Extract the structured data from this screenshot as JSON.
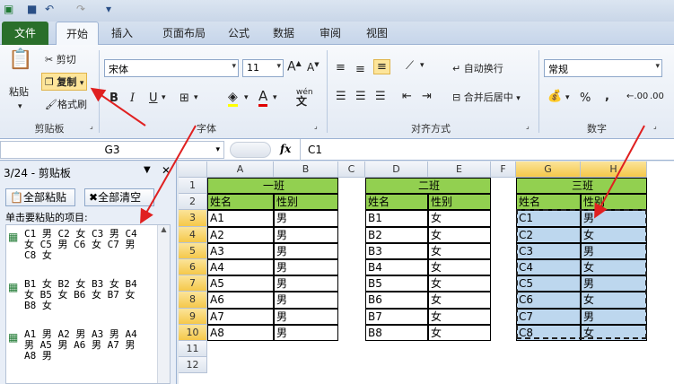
{
  "tabs": [
    "文件",
    "开始",
    "插入",
    "页面布局",
    "公式",
    "数据",
    "审阅",
    "视图"
  ],
  "ribbon": {
    "paste": "粘贴",
    "cut": "剪切",
    "copy": "复制",
    "format_painter": "格式刷",
    "clipboard_group": "剪贴板",
    "font_name": "宋体",
    "font_size": "11",
    "font_group": "字体",
    "wrap_text": "自动换行",
    "merge_center": "合并后居中",
    "align_group": "对齐方式",
    "number_format": "常规",
    "number_group": "数字",
    "bold": "B",
    "italic": "I",
    "underline": "U",
    "percent": "%",
    "dec_inc": ".00",
    "dec_dec": ".00"
  },
  "formula_bar": {
    "name_box": "G3",
    "fx": "fx",
    "content": "C1"
  },
  "pane": {
    "title": "3/24 - 剪贴板",
    "paste_all": "全部粘贴",
    "clear_all": "全部清空",
    "hint": "单击要粘贴的项目:",
    "items": [
      "C1 男 C2 女 C3 男 C4 女 C5 男 C6 女 C7 男 C8 女",
      "B1 女 B2 女 B3 女 B4 女 B5 女 B6 女 B7 女 B8 女",
      "A1 男 A2 男 A3 男 A4 男 A5 男 A6 男 A7 男 A8 男"
    ]
  },
  "sheet": {
    "columns": [
      "A",
      "B",
      "C",
      "D",
      "E",
      "F",
      "G",
      "H"
    ],
    "rows": [
      "1",
      "2",
      "3",
      "4",
      "5",
      "6",
      "7",
      "8",
      "9",
      "10",
      "11",
      "12"
    ],
    "class1": "一班",
    "class2": "二班",
    "class3": "三班",
    "name_header": "姓名",
    "gender_header": "性别",
    "A": [
      "A1",
      "A2",
      "A3",
      "A4",
      "A5",
      "A6",
      "A7",
      "A8"
    ],
    "B": [
      "男",
      "男",
      "男",
      "男",
      "男",
      "男",
      "男",
      "男"
    ],
    "D": [
      "B1",
      "B2",
      "B3",
      "B4",
      "B5",
      "B6",
      "B7",
      "B8"
    ],
    "E": [
      "女",
      "女",
      "女",
      "女",
      "女",
      "女",
      "女",
      "女"
    ],
    "G": [
      "C1",
      "C2",
      "C3",
      "C4",
      "C5",
      "C6",
      "C7",
      "C8"
    ],
    "H": [
      "男",
      "女",
      "男",
      "女",
      "男",
      "女",
      "男",
      "女"
    ]
  },
  "colors": {
    "header_green": "#92d050",
    "selection": "#bdd7ee",
    "file_tab": "#2a6f2b"
  }
}
